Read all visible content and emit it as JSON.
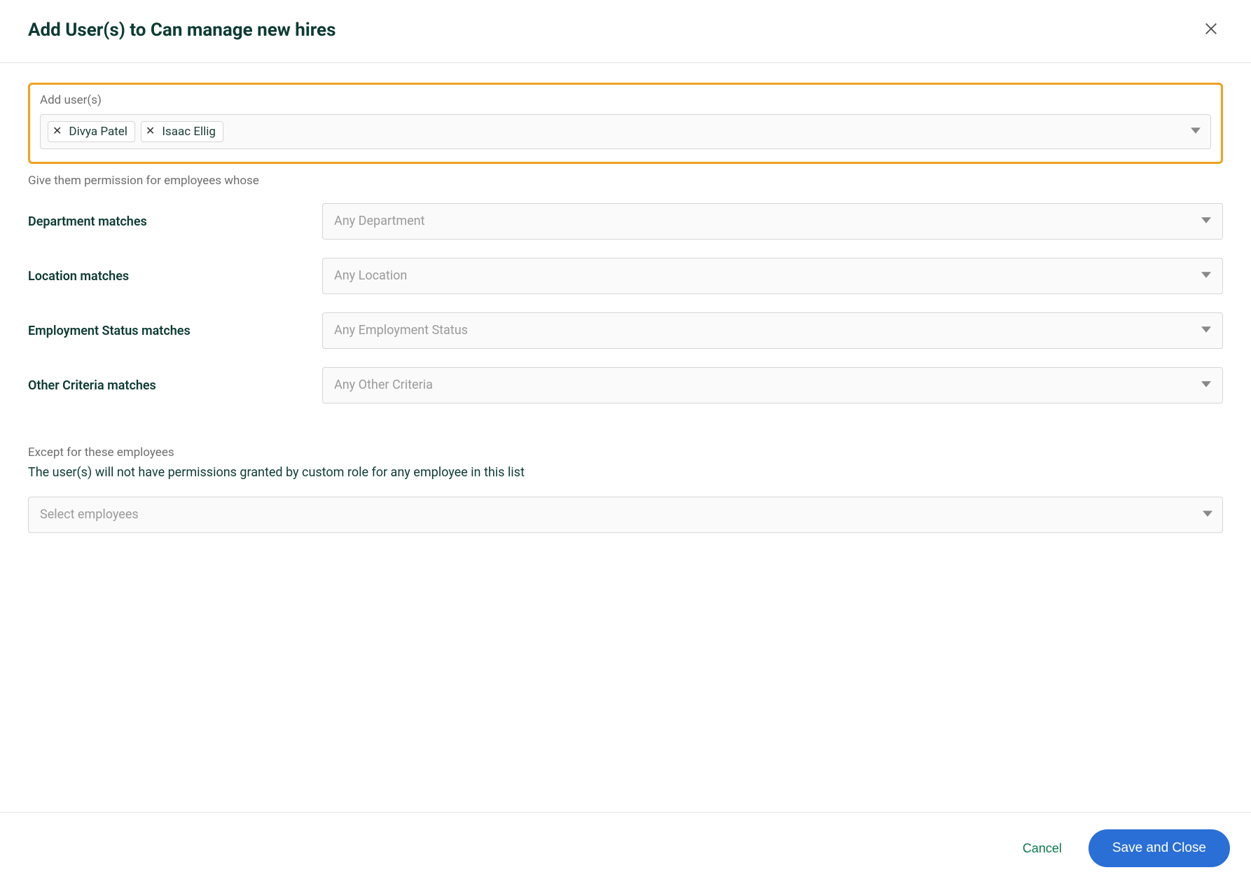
{
  "header": {
    "title": "Add User(s) to Can manage new hires"
  },
  "addUsers": {
    "label": "Add user(s)",
    "chips": [
      "Divya Patel",
      "Isaac Ellig"
    ]
  },
  "permissionIntro": "Give them permission for employees whose",
  "criteria": [
    {
      "label": "Department matches",
      "placeholder": "Any Department"
    },
    {
      "label": "Location matches",
      "placeholder": "Any Location"
    },
    {
      "label": "Employment Status matches",
      "placeholder": "Any Employment Status"
    },
    {
      "label": "Other Criteria matches",
      "placeholder": "Any Other Criteria"
    }
  ],
  "except": {
    "label": "Except for these employees",
    "description": "The user(s) will not have permissions granted by custom role for any employee in this list",
    "placeholder": "Select employees"
  },
  "footer": {
    "cancel": "Cancel",
    "save": "Save and Close"
  }
}
